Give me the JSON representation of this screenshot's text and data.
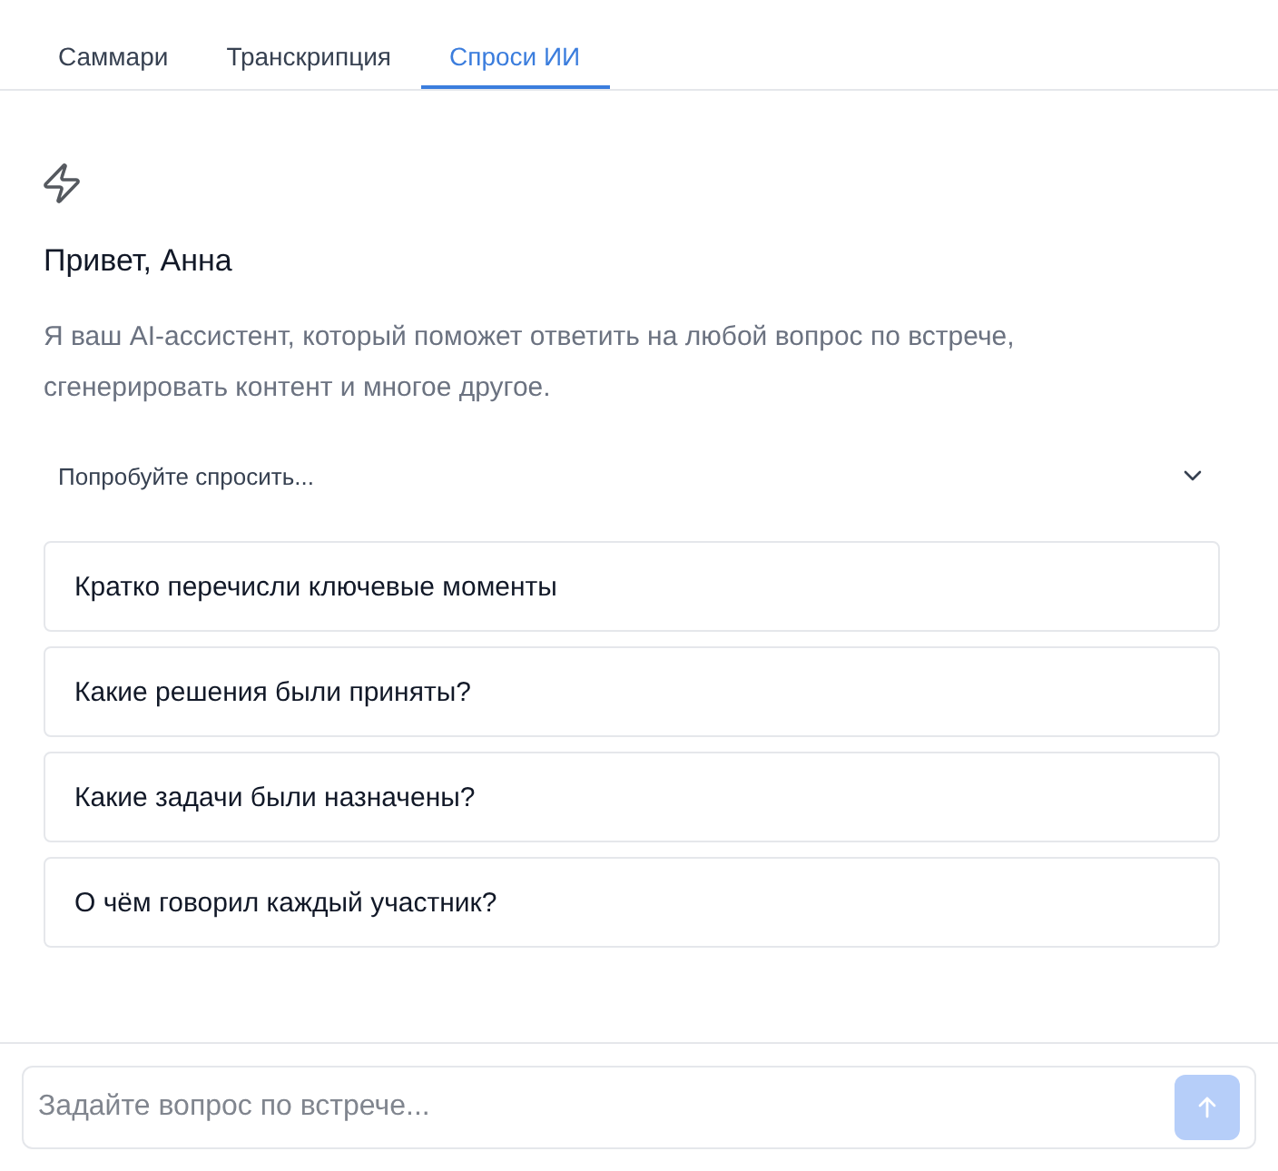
{
  "tabs": [
    {
      "label": "Саммари",
      "selected": false
    },
    {
      "label": "Транскрипция",
      "selected": false
    },
    {
      "label": "Спроси ИИ",
      "selected": true
    }
  ],
  "greeting": {
    "title": "Привет, Анна",
    "description": "Я ваш AI-ассистент, который поможет ответить на любой вопрос по встрече, сгенерировать контент и многое другое."
  },
  "suggestions": {
    "label": "Попробуйте спросить...",
    "expanded": true,
    "items": [
      "Кратко перечисли ключевые моменты",
      "Какие решения были приняты?",
      "Какие задачи были назначены?",
      "О чём говорил каждый участник?"
    ]
  },
  "composer": {
    "placeholder": "Задайте вопрос по встрече...",
    "send_disabled": true
  }
}
